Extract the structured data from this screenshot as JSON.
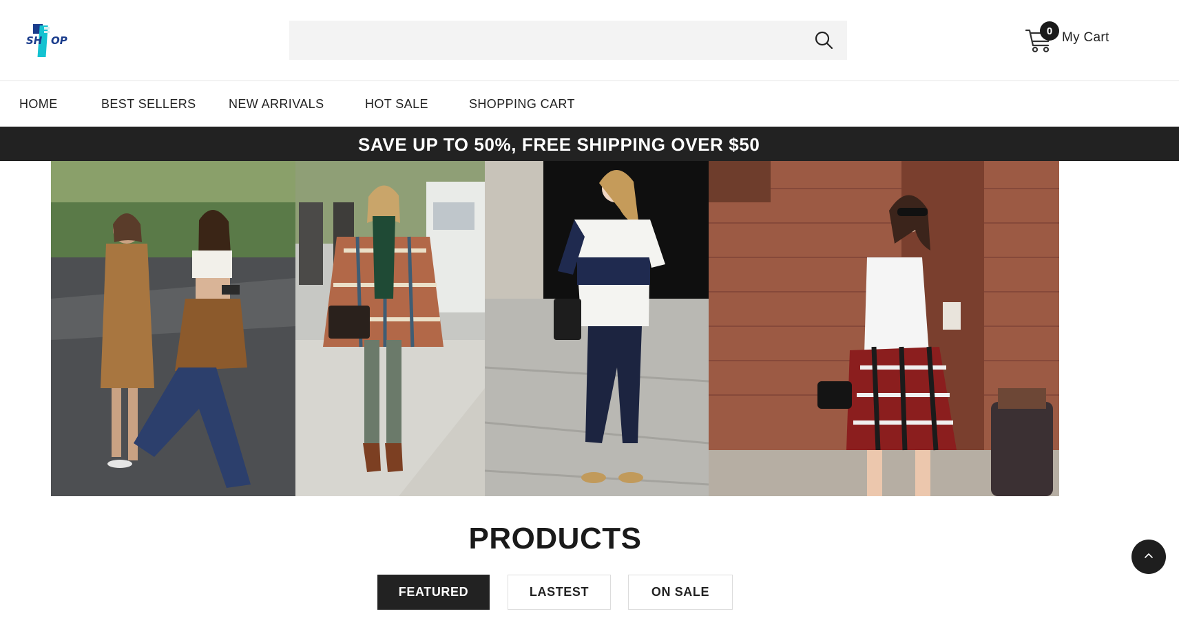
{
  "header": {
    "logo_text": "SHOP",
    "search": {
      "placeholder": "",
      "value": ""
    },
    "cart": {
      "count": "0",
      "label": "My Cart"
    }
  },
  "nav": {
    "items": [
      "HOME",
      "BEST SELLERS",
      "NEW ARRIVALS",
      "HOT SALE",
      "SHOPPING CART"
    ]
  },
  "promo": {
    "text": "SAVE UP TO 50%, FREE SHIPPING OVER $50"
  },
  "banner": {
    "panels": [
      "street-style-two-women",
      "street-style-plaid-poncho",
      "street-style-striped-tee",
      "street-style-plaid-waist-tie"
    ]
  },
  "products": {
    "title": "PRODUCTS",
    "tabs": [
      "FEATURED",
      "LASTEST",
      "ON SALE"
    ],
    "active_tab": "FEATURED"
  },
  "colors": {
    "dark": "#222222",
    "logo_blue": "#1a3c8c",
    "logo_cyan": "#14c2d1"
  },
  "icons": [
    "search-icon",
    "cart-icon",
    "chevron-up-icon"
  ]
}
